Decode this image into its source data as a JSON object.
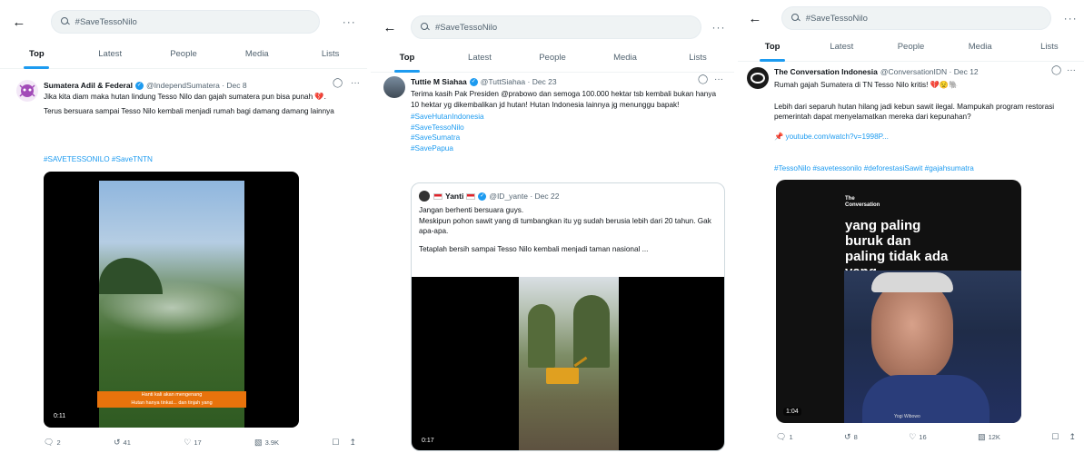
{
  "search": {
    "query": "#SaveTessoNilo"
  },
  "tabs": [
    "Top",
    "Latest",
    "People",
    "Media",
    "Lists"
  ],
  "icons": {
    "back": "arrow-left-icon",
    "more": "more-icon",
    "reply": "reply-icon",
    "retweet": "retweet-icon",
    "like": "heart-icon",
    "views": "views-icon",
    "bookmark": "bookmark-icon",
    "share": "share-icon",
    "grok": "grok-icon"
  },
  "colors": {
    "accent": "#1d9bf0",
    "text": "#0f1419",
    "muted": "#536471",
    "caption_bar": "#e8730c"
  },
  "panels": [
    {
      "tweet": {
        "name": "Sumatera Adil & Federal",
        "handle": "@IndependSumatera · Dec 8",
        "lines": [
          "Jika kita diam maka hutan lindung Tesso Nilo dan gajah sumatera pun bisa punah 💔.",
          "Terus bersuara sampai Tesso Nilo kembali menjadi rumah bagi damang damang lainnya"
        ],
        "hashtags": "#SAVETESSONILO #SaveTNTN",
        "media": {
          "timer": "0:11",
          "caption1": "Hanti kali akan mengenang",
          "caption2": "Hutan hanya tinkat... dan tinjah yang"
        },
        "actions": {
          "reply": "2",
          "retweet": "41",
          "like": "17",
          "views": "3.9K"
        }
      }
    },
    {
      "tweet": {
        "name": "Tuttie M Siahaa",
        "handle": "@TuttSiahaa · Dec 23",
        "lines": [
          "Terima kasih Pak Presiden @prabowo dan semoga 100.000 hektar tsb kembali bukan hanya 10 hektar yg dikembalikan jd hutan! Hutan Indonesia lainnya jg menunggu bapak!"
        ],
        "hashtags_list": [
          "#SaveHutanIndonesia",
          "#SaveTessoNilo",
          "#SaveSumatra",
          "#SavePapua"
        ],
        "quote": {
          "name": "Yanti",
          "handle": "@ID_yante · Dec 22",
          "lines": [
            "Jangan berhenti bersuara guys.",
            "Meskipun pohon sawit yang di tumbangkan itu yg sudah berusia lebih dari 20 tahun. Gak apa-apa.",
            "Tetaplah bersih sampai Tesso Nilo kembali menjadi taman nasional ..."
          ],
          "timer": "0:17"
        }
      }
    },
    {
      "tweet": {
        "name": "The Conversation Indonesia",
        "handle": "@ConversationIDN · Dec 12",
        "lines": [
          "Rumah gajah Sumatera di TN Tesso Nilo kritis! 💔😟🐘",
          "Lebih dari separuh hutan hilang jadi kebun sawit ilegal. Mampukah program restorasi pemerintah dapat menyelamatkan mereka dari kepunahan?",
          "📌 youtube.com/watch?v=1998P..."
        ],
        "hashtags": "#TessoNilo #savetessonilo #deforestasiSawit #gajahsumatra",
        "media": {
          "badge1": "The",
          "badge2": "Conversation",
          "overlay": "yang paling buruk dan paling tidak ada yang",
          "timer": "1:04",
          "credit": "Yogi Wibowo"
        },
        "actions": {
          "reply": "1",
          "retweet": "8",
          "like": "16",
          "views": "12K"
        }
      }
    }
  ]
}
